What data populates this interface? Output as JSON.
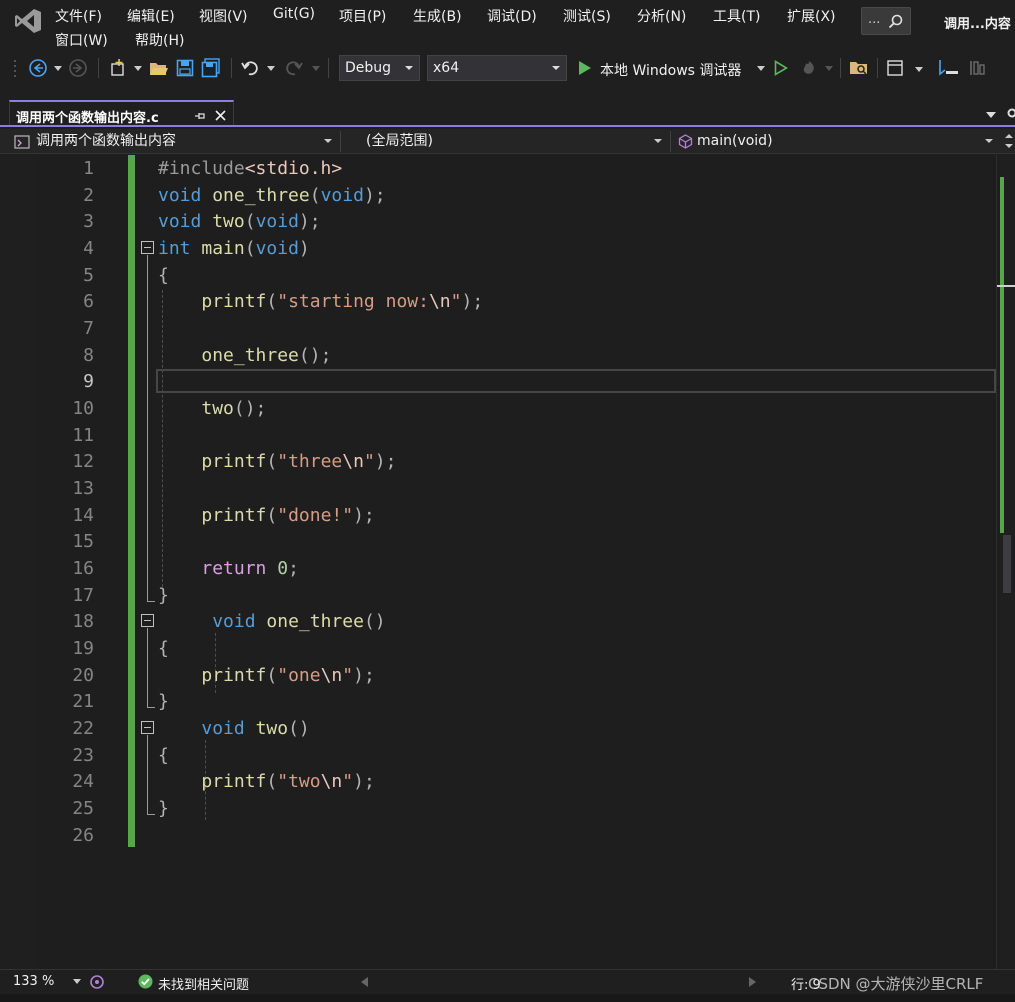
{
  "menu": {
    "items": [
      "文件(F)",
      "编辑(E)",
      "视图(V)",
      "Git(G)",
      "项目(P)",
      "生成(B)",
      "调试(D)",
      "测试(S)",
      "分析(N)",
      "工具(T)",
      "扩展(X)"
    ],
    "items_row2": [
      "窗口(W)",
      "帮助(H)"
    ],
    "search_placeholder": "...",
    "window_title": "调用...内容"
  },
  "toolbar": {
    "configuration": "Debug",
    "platform": "x64",
    "run_label": "本地 Windows 调试器",
    "accent_run": "#5cb85c"
  },
  "tabs": [
    {
      "title": "调用两个函数输出内容.c",
      "active": true
    }
  ],
  "navbar": {
    "project": "调用两个函数输出内容",
    "scope": "(全局范围)",
    "member": "main(void)"
  },
  "editor": {
    "current_line": "9",
    "lines": [
      {
        "n": "1",
        "code": "#include<stdio.h>"
      },
      {
        "n": "2",
        "code": "void one_three(void);"
      },
      {
        "n": "3",
        "code": "void two(void);"
      },
      {
        "n": "4",
        "code": "int main(void)"
      },
      {
        "n": "5",
        "code": "{"
      },
      {
        "n": "6",
        "code": "    printf(\"starting now:\\n\");"
      },
      {
        "n": "7",
        "code": ""
      },
      {
        "n": "8",
        "code": "    one_three();"
      },
      {
        "n": "9",
        "code": ""
      },
      {
        "n": "10",
        "code": "    two();"
      },
      {
        "n": "11",
        "code": ""
      },
      {
        "n": "12",
        "code": "    printf(\"three\\n\");"
      },
      {
        "n": "13",
        "code": ""
      },
      {
        "n": "14",
        "code": "    printf(\"done!\");"
      },
      {
        "n": "15",
        "code": ""
      },
      {
        "n": "16",
        "code": "    return 0;"
      },
      {
        "n": "17",
        "code": "}"
      },
      {
        "n": "18",
        "code": "     void one_three()"
      },
      {
        "n": "19",
        "code": "{"
      },
      {
        "n": "20",
        "code": "    printf(\"one\\n\");"
      },
      {
        "n": "21",
        "code": "}"
      },
      {
        "n": "22",
        "code": "    void two()"
      },
      {
        "n": "23",
        "code": "{"
      },
      {
        "n": "24",
        "code": "    printf(\"two\\n\");"
      },
      {
        "n": "25",
        "code": "}"
      },
      {
        "n": "26",
        "code": ""
      }
    ],
    "tokens": {
      "l1_pp": "#include",
      "l1_inc": "<stdio.h>",
      "void": "void",
      "int": "int",
      "return": "return",
      "one_three": "one_three",
      "two": "two",
      "main": "main",
      "printf": "printf",
      "s6a": "\"starting now:",
      "s6esc": "\\n",
      "s6b": "\"",
      "s12a": "\"three",
      "s12esc": "\\n",
      "s12b": "\"",
      "s14": "\"done!\"",
      "s20a": "\"one",
      "s20esc": "\\n",
      "s20b": "\"",
      "s24a": "\"two",
      "s24esc": "\\n",
      "s24b": "\"",
      "zero": "0"
    }
  },
  "status": {
    "zoom": "133 %",
    "issues": "未找到相关问题",
    "position": "行: 9",
    "watermark": "CSDN @大游侠沙里CRLF",
    "line_ending": "CRLF"
  }
}
